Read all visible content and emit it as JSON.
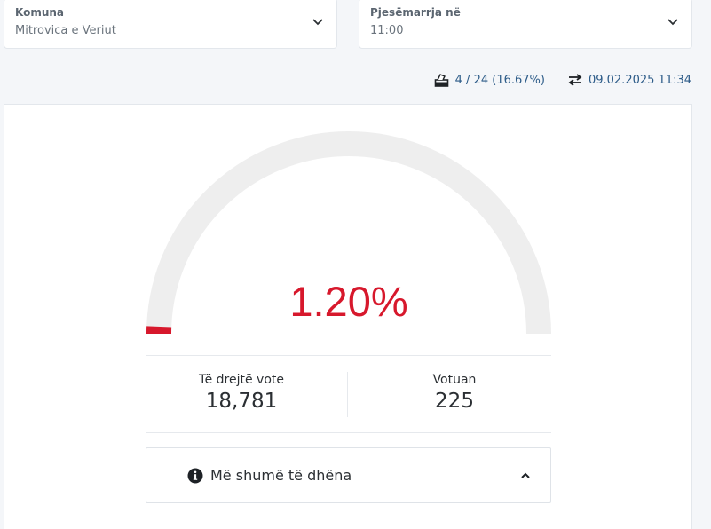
{
  "filters": {
    "municipality": {
      "label": "Komuna",
      "value": "Mitrovica e Veriut"
    },
    "turnout_at": {
      "label": "Pjesëmarrja në",
      "value": "11:00"
    }
  },
  "stats": {
    "stations": "4 / 24 (16.67%)",
    "updated": "09.02.2025 11:34"
  },
  "gauge": {
    "percent_text": "1.20%",
    "value": 1.2,
    "max": 100,
    "fill_color": "#d7182c",
    "track_color": "#eeeeee"
  },
  "metrics": {
    "eligible": {
      "label": "Të drejtë vote",
      "value": "18,781"
    },
    "voted": {
      "label": "Votuan",
      "value": "225"
    }
  },
  "details": {
    "label": "Më shumë të dhëna"
  },
  "icons": {
    "ballot": "ballot-box-icon",
    "refresh": "exchange-arrows-icon",
    "info": "info-circle-icon",
    "collapse": "chevron-up-icon",
    "dropdown": "chevron-down-icon"
  }
}
